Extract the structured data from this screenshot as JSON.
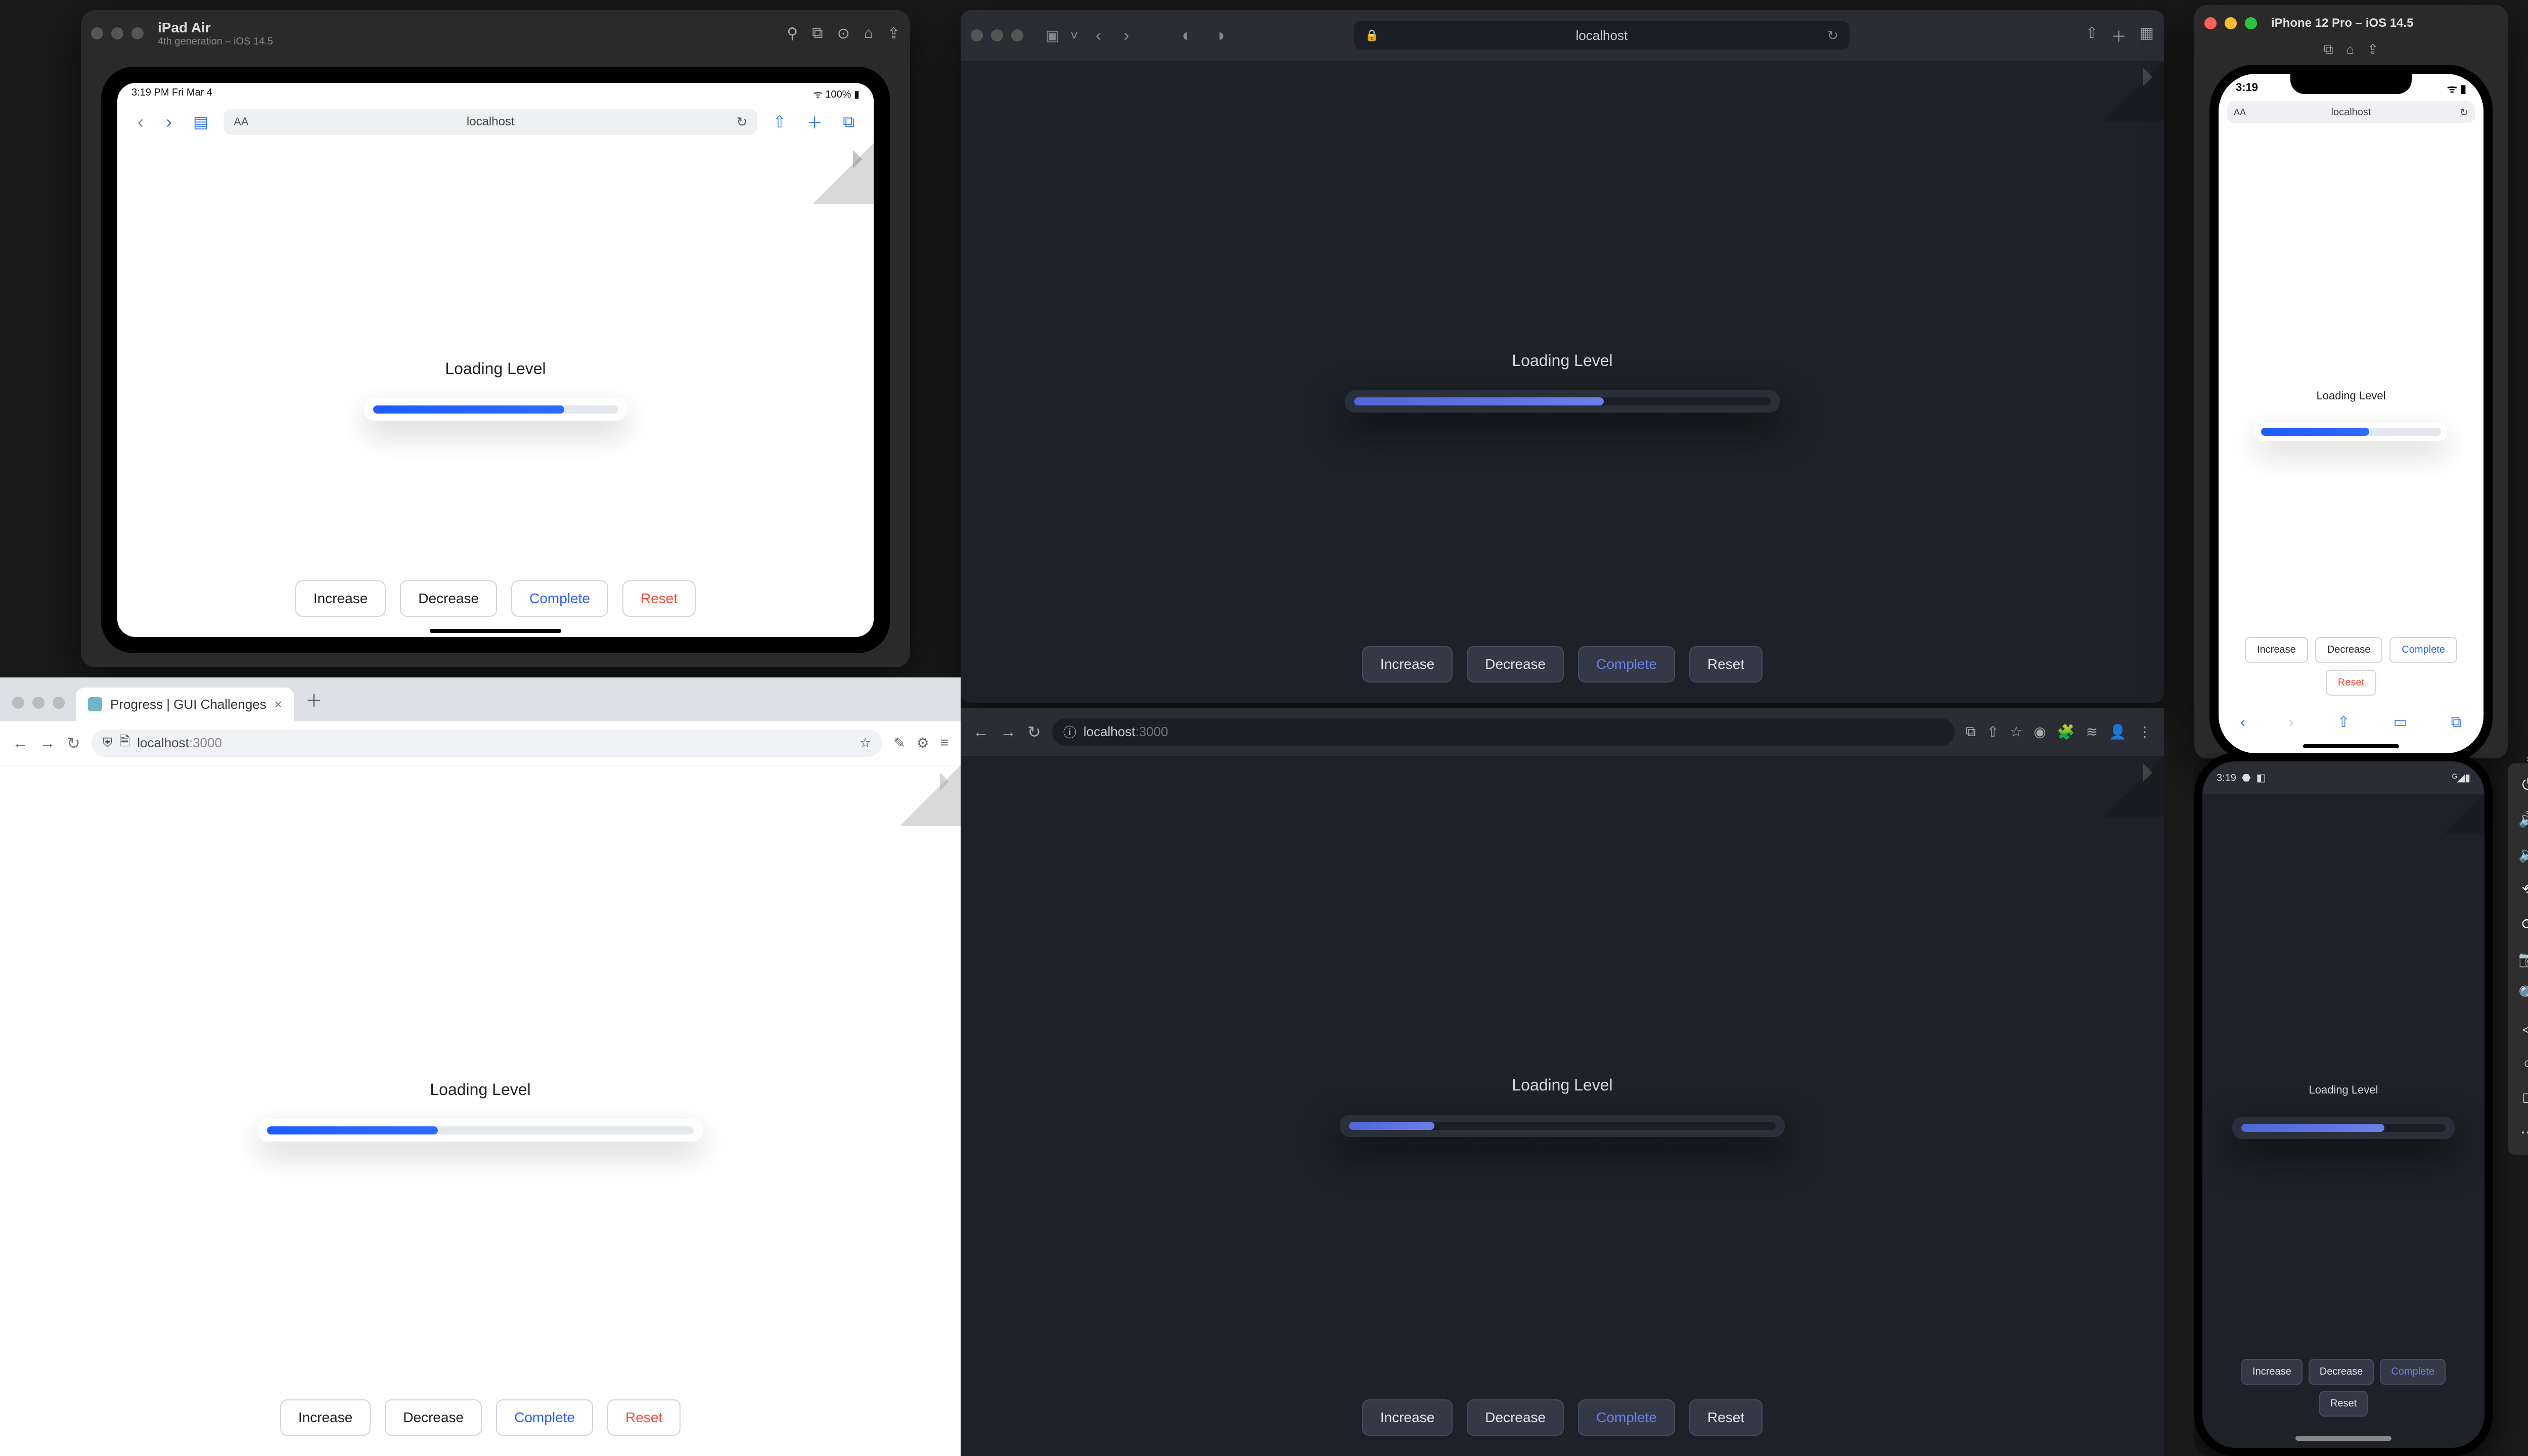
{
  "common": {
    "loading_label": "Loading Level",
    "buttons": {
      "increase": "Increase",
      "decrease": "Decrease",
      "complete": "Complete",
      "reset": "Reset"
    },
    "url_host": "localhost",
    "url_port": ":3000"
  },
  "ipad": {
    "device": "iPad Air",
    "generation": "4th generation – iOS 14.5",
    "status_left": "3:19 PM  Fri Mar 4",
    "status_right": "100%",
    "progress_pct": 78
  },
  "safari": {
    "progress_pct": 60
  },
  "chrome_light": {
    "tab_title": "Progress | GUI Challenges",
    "progress_pct": 40
  },
  "chrome_dark": {
    "progress_pct": 20
  },
  "iphone": {
    "device": "iPhone 12 Pro – iOS 14.5",
    "time": "3:19",
    "progress_pct": 60
  },
  "android": {
    "time": "3:19",
    "progress_pct": 70
  }
}
